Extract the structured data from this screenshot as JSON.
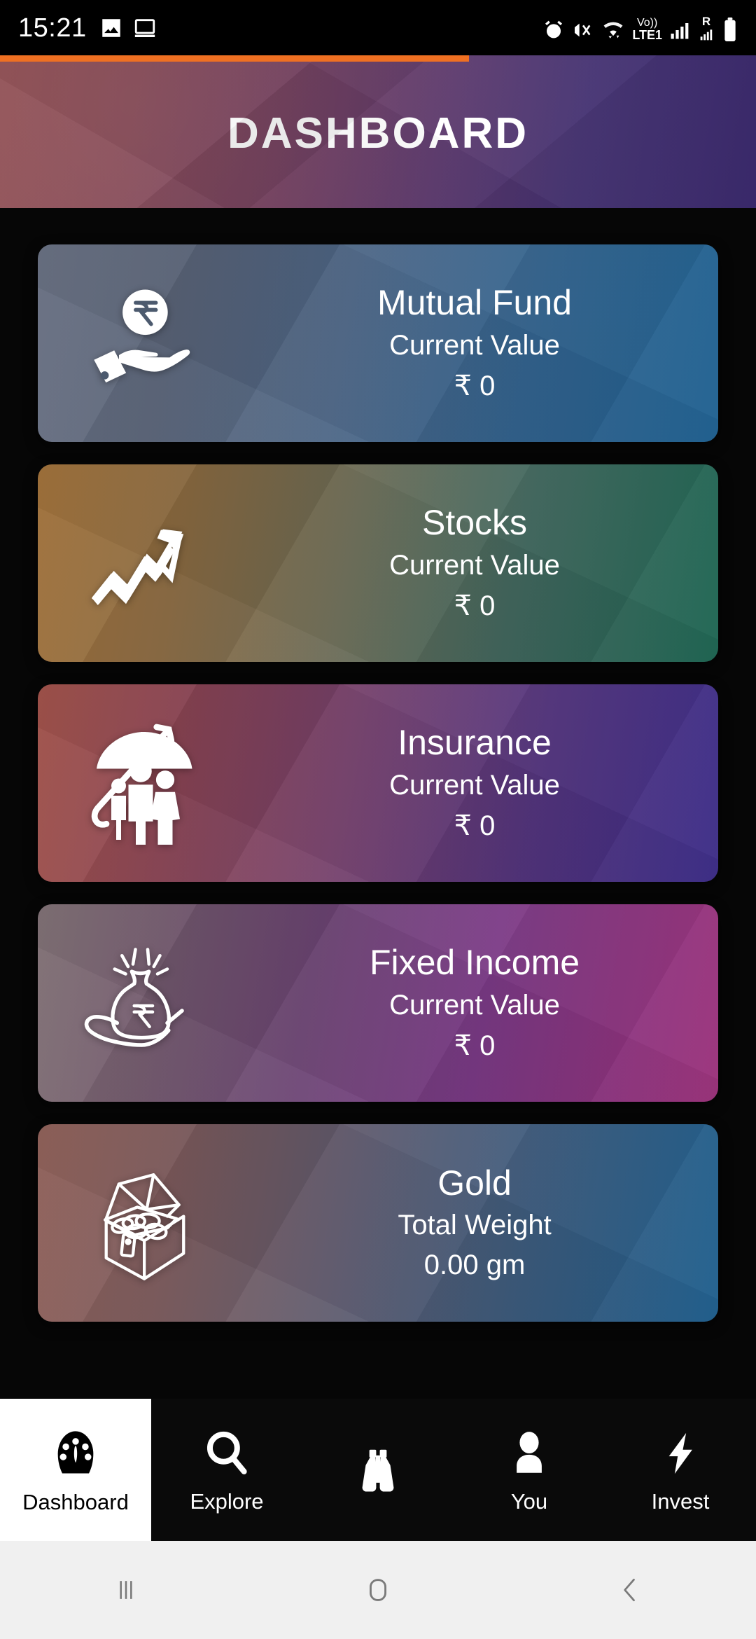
{
  "statusbar": {
    "time": "15:21",
    "left_icons": [
      "image-icon",
      "screen-icon"
    ],
    "right_icons": [
      "alarm-icon",
      "vibrate-icon",
      "wifi-icon",
      "volte-icon",
      "signal-icon",
      "roaming-signal-icon",
      "battery-icon"
    ],
    "network_label": "LTE1",
    "volte_label": "Vo))",
    "roaming_label": "R"
  },
  "progress": {
    "percent": 62,
    "color": "#ef7022"
  },
  "header": {
    "title": "DASHBOARD",
    "gradient_from": "#8d4a4f",
    "gradient_to": "#36256a"
  },
  "cards": [
    {
      "id": "mutual-fund",
      "icon": "hand-rupee-coin-icon",
      "title": "Mutual Fund",
      "label": "Current Value",
      "value": "₹ 0",
      "gradient_class": "g-mf",
      "gradient_from": "#62697c",
      "gradient_to": "#1d5f8f"
    },
    {
      "id": "stocks",
      "icon": "trending-up-arrow-icon",
      "title": "Stocks",
      "label": "Current Value",
      "value": "₹ 0",
      "gradient_class": "g-stk",
      "gradient_from": "#9b6a32",
      "gradient_to": "#1b6350"
    },
    {
      "id": "insurance",
      "icon": "umbrella-family-icon",
      "title": "Insurance",
      "label": "Current Value",
      "value": "₹ 0",
      "gradient_class": "g-ins",
      "gradient_from": "#9b4a42",
      "gradient_to": "#3a2a86"
    },
    {
      "id": "fixed-income",
      "icon": "money-bag-hand-icon",
      "title": "Fixed Income",
      "label": "Current Value",
      "value": "₹ 0",
      "gradient_class": "g-fi",
      "gradient_from": "#7a6a6e",
      "gradient_to": "#9a2f79"
    },
    {
      "id": "gold",
      "icon": "treasure-chest-coins-icon",
      "title": "Gold",
      "label": "Total Weight",
      "value": "0.00 gm",
      "gradient_class": "g-gold",
      "gradient_from": "#8a5a52",
      "gradient_to": "#1d5d8c"
    }
  ],
  "tabbar": {
    "items": [
      {
        "id": "dashboard",
        "label": "Dashboard",
        "icon": "speedometer-icon",
        "active": true
      },
      {
        "id": "explore",
        "label": "Explore",
        "icon": "search-icon",
        "active": false
      },
      {
        "id": "discover",
        "label": "",
        "icon": "binoculars-icon",
        "active": false
      },
      {
        "id": "you",
        "label": "You",
        "icon": "person-icon",
        "active": false
      },
      {
        "id": "invest",
        "label": "Invest",
        "icon": "lightning-bolt-icon",
        "active": false
      }
    ]
  },
  "navbar": {
    "items": [
      {
        "id": "recents",
        "icon": "recents-icon"
      },
      {
        "id": "home",
        "icon": "home-icon"
      },
      {
        "id": "back",
        "icon": "back-icon"
      }
    ]
  }
}
